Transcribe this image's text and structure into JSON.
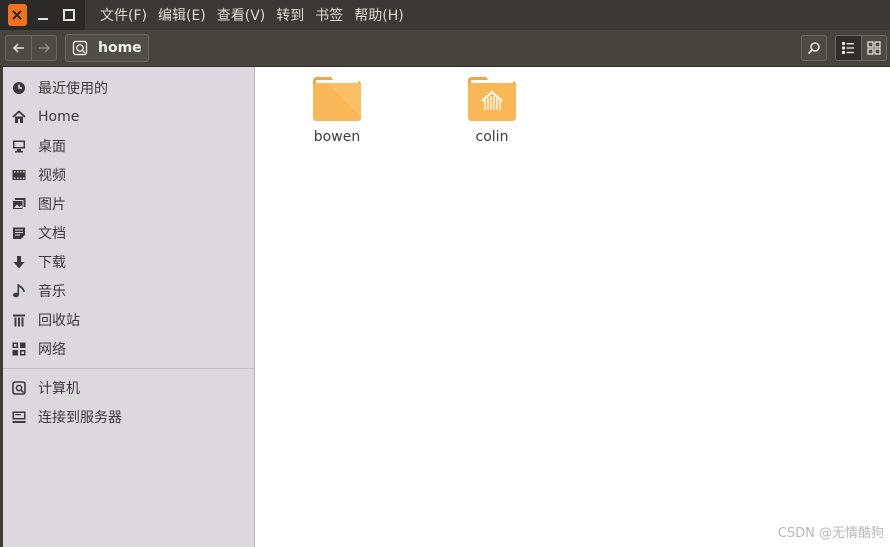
{
  "menubar": {
    "items": [
      "文件(F)",
      "编辑(E)",
      "查看(V)",
      "转到",
      "书签",
      "帮助(H)"
    ]
  },
  "toolbar": {
    "breadcrumb": "home",
    "icons": {
      "back": "arrow-left-icon",
      "forward": "arrow-right-icon",
      "search": "search-icon",
      "list_view": "list-view-icon",
      "grid_view": "grid-view-icon"
    }
  },
  "sidebar": {
    "items": [
      {
        "label": "最近使用的",
        "icon": "recent-icon"
      },
      {
        "label": "Home",
        "icon": "home-icon"
      },
      {
        "label": "桌面",
        "icon": "desktop-icon"
      },
      {
        "label": "视频",
        "icon": "video-icon"
      },
      {
        "label": "图片",
        "icon": "picture-icon"
      },
      {
        "label": "文档",
        "icon": "document-icon"
      },
      {
        "label": "下载",
        "icon": "download-icon"
      },
      {
        "label": "音乐",
        "icon": "music-icon"
      },
      {
        "label": "回收站",
        "icon": "trash-icon"
      },
      {
        "label": "网络",
        "icon": "network-icon"
      }
    ],
    "devices": [
      {
        "label": "计算机",
        "icon": "computer-icon"
      },
      {
        "label": "连接到服务器",
        "icon": "server-icon"
      }
    ]
  },
  "files": [
    {
      "name": "bowen",
      "icon": "folder-icon"
    },
    {
      "name": "colin",
      "icon": "home-folder-icon"
    }
  ],
  "watermark": "CSDN @无情酷狗",
  "colors": {
    "folder": "#f9b857",
    "accent": "#f0721f"
  }
}
